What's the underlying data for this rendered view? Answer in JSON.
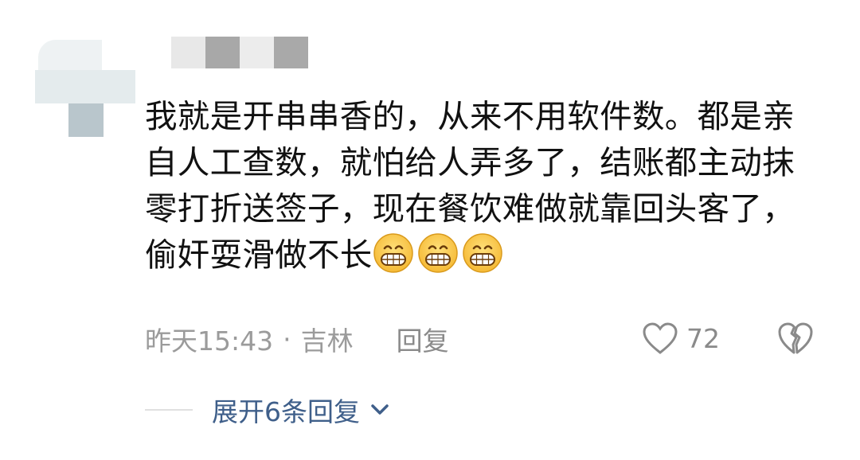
{
  "comment": {
    "user": {
      "name_blurred": true
    },
    "text": "我就是开串串香的，从来不用软件数。都是亲自人工查数，就怕给人弄多了，结账都主动抹零打折送签子，现在餐饮难做就靠回头客了，偷奸耍滑做不长",
    "emoji_count": 3,
    "emoji_name": "grinning-face",
    "time": "昨天15:43",
    "separator": "·",
    "location": "吉林",
    "reply_label": "回复",
    "like_count": "72",
    "expand_label": "展开6条回复"
  },
  "colors": {
    "text": "#111111",
    "meta": "#9b9b9b",
    "link": "#3f5f8a"
  }
}
